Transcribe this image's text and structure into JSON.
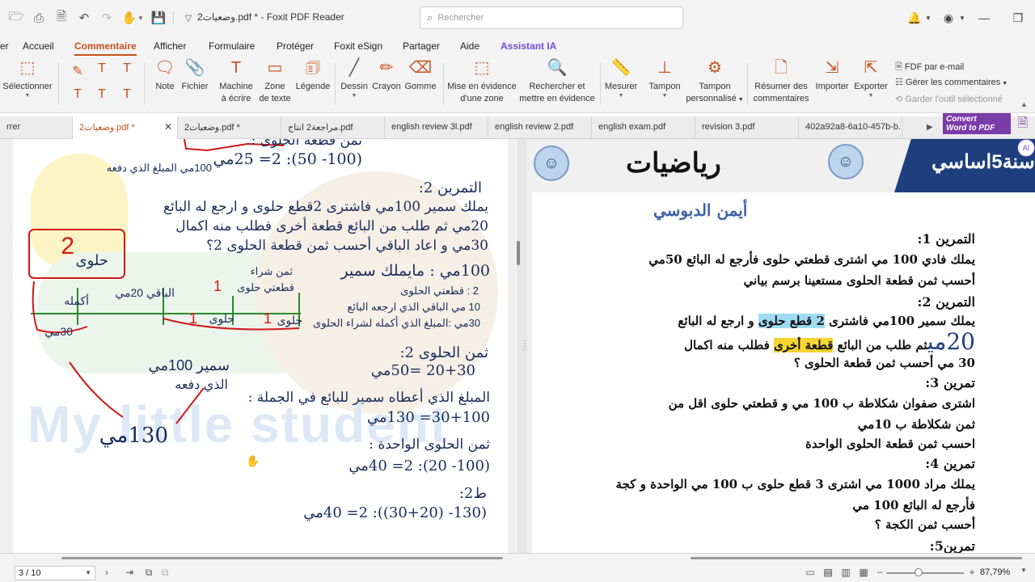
{
  "window": {
    "title": "وضعيات2.pdf * - Foxit PDF Reader",
    "search_placeholder": "Rechercher"
  },
  "menu": {
    "tabs": [
      {
        "label": "er"
      },
      {
        "label": "Accueil"
      },
      {
        "label": "Commentaire"
      },
      {
        "label": "Afficher"
      },
      {
        "label": "Formulaire"
      },
      {
        "label": "Protéger"
      },
      {
        "label": "Foxit eSign"
      },
      {
        "label": "Partager"
      },
      {
        "label": "Aide"
      },
      {
        "label": "Assistant IA"
      }
    ]
  },
  "ribbon": {
    "select": "Sélectionner",
    "note": "Note",
    "file": "Fichier",
    "typewriter_1": "Machine",
    "typewriter_2": "à écrire",
    "textbox_1": "Zone",
    "textbox_2": "de texte",
    "callout": "Légende",
    "drawing": "Dessin",
    "pencil": "Crayon",
    "eraser": "Gomme",
    "highlight_area_1": "Mise en évidence",
    "highlight_area_2": "d'une zone",
    "search_highlight_1": "Rechercher et",
    "search_highlight_2": "mettre en évidence",
    "measure": "Mesurer",
    "stamp": "Tampon",
    "custom_stamp_1": "Tampon",
    "custom_stamp_2": "personnalisé",
    "summarize_1": "Résumer des",
    "summarize_2": "commentaires",
    "import": "Importer",
    "export": "Exporter",
    "fdf_email": "FDF par e-mail",
    "manage_comments": "Gérer les commentaires",
    "keep_tool": "Garder l'outil sélectionné"
  },
  "doc_tabs": [
    {
      "label": "rrer"
    },
    {
      "label": "وضعيات2.pdf *"
    },
    {
      "label": "وضعيات2.pdf *"
    },
    {
      "label": "مراجعة2 انتاج.pdf"
    },
    {
      "label": "english review 3l.pdf"
    },
    {
      "label": "english review 2.pdf"
    },
    {
      "label": "english exam.pdf"
    },
    {
      "label": "revision 3.pdf"
    },
    {
      "label": "402a92a8-6a10-457b-b..."
    }
  ],
  "convert_banner": {
    "line1": "Convert",
    "line2": "Word to PDF"
  },
  "left_page": {
    "watermark": "My little student",
    "top_note": "ثمن قطعة الحلوى :",
    "calc_1": "(100- 50): 2= 25مي",
    "paid_note": "100مي المبلغ الذي دفعه",
    "ex2_title": "التمرين 2:",
    "ex2_l1": "يملك سمير 100مي فاشترى 2قطع حلوى و ارجع له البائع",
    "ex2_l2": "20مي ثم طلب من البائع قطعة أخرى فطلب منه اكمال",
    "ex2_l3": "30مي و اعاد الباقي أحسب ثمن قطعة الحلوى 2؟",
    "sweet_box": "حلوى",
    "sweet_box_num": "2",
    "bar_complete": "أكمله",
    "bar_rest": "الباقي 20مي",
    "bar_sweet_a": "حلوى",
    "bar_sweet_b": "حلوى",
    "bar_one_a": "1",
    "bar_one_b": "1",
    "bar_one_c": "1",
    "bar_30": "30مي",
    "buy_price_1": "ثمن شراء",
    "buy_price_2": "قطعتي حلوى",
    "samir_has": "100مي : مايملك سمير",
    "leg_1": "2 : قطعتي الحلوى",
    "leg_2": "10 مي الباقي الذي ارجعه البائع",
    "leg_3": "30مي :المبلغ الذي أكمله لشراء الحلوى",
    "price2": "ثمن الحلوى 2:",
    "calc_2": "20+30 =50مي",
    "total_paid": "المبلغ الذي أعطاه سمير للبائع في الجملة :",
    "calc_3": "30+100= 130مي",
    "samir_100": "سمير 100مي",
    "paid_by": "الذي دفعه",
    "big_130": "130مي",
    "unit_price": "ثمن الحلوى الواحدة :",
    "calc_4": "(100- 20): 2= 40مي",
    "method2": "ط2:",
    "calc_5": "(130- (30+20)): 2= 40مي"
  },
  "right_page": {
    "grade": "سنة5اساسي",
    "subject": "رياضيات",
    "author": "أيمن الدبوسي",
    "ex1_title": "التمرين 1:",
    "ex1_l1": "يملك فادي 100 مي اشترى قطعتي حلوى فأرجع له البائع 50مي",
    "ex1_l2": "أحسب ثمن قطعة الحلوى مستعينا برسم بياني",
    "ex2_title": "التمرين 2:",
    "ex2_l1_a": "يملك سمير 100مي فاشترى ",
    "ex2_l1_hl": "2 قطع حلوى",
    "ex2_l1_b": " و ارجع له البائع",
    "ex2_l2_big": "20مي",
    "ex2_l2_a": "ثم طلب من البائع ",
    "ex2_l2_hl": "قطعة أخرى",
    "ex2_l2_b": " فطلب منه اكمال",
    "ex2_l3": "30 مي  أحسب ثمن قطعة الحلوى ؟",
    "ex3_title": "تمرين 3:",
    "ex3_l1": "اشترى صفوان  شكلاطة ب 100 مي  و قطعتي حلوى  اقل من",
    "ex3_l2": "ثمن شكلاطة ب 10مي",
    "ex3_l3": "احسب ثمن قطعة الحلوى الواحدة",
    "ex4_title": "تمرين 4:",
    "ex4_l1": "يملك مراد 1000 مي  اشترى 3 قطع حلوى ب 100 مي الواحدة و كجة",
    "ex4_l2": "فأرجع له البائع 100 مي",
    "ex4_l3": "أحسب ثمن الكجة ؟",
    "ex5_title": "تمرين5:"
  },
  "status": {
    "page": "3 / 10",
    "zoom": "87,79%",
    "zoom_fraction": 0.42
  },
  "colors": {
    "accent": "#c8501e",
    "ai": "#6b4fd8",
    "banner": "#1e3f7c",
    "ink_red": "#d01818",
    "ink_green": "#2b8a2b"
  }
}
